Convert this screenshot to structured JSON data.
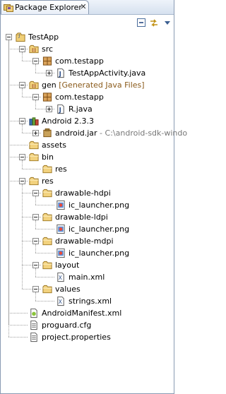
{
  "view": {
    "tab_title": "Package Explorer",
    "close_glyph": "✕",
    "toolbar": [
      "collapse-all-icon",
      "link-with-editor-icon",
      "view-menu-icon"
    ]
  },
  "tree": [
    {
      "label": "TestApp",
      "icon": "java-project-icon",
      "toggle": "expanded",
      "level": 0
    },
    {
      "label": "src",
      "icon": "source-folder-icon",
      "toggle": "expanded",
      "level": 1
    },
    {
      "label": "com.testapp",
      "icon": "package-icon",
      "toggle": "expanded",
      "level": 2
    },
    {
      "label": "TestAppActivity.java",
      "icon": "java-file-icon",
      "toggle": "collapsed",
      "level": 3
    },
    {
      "label": "gen",
      "decoration": "[Generated Java Files]",
      "icon": "source-folder-icon",
      "toggle": "expanded",
      "level": 1
    },
    {
      "label": "com.testapp",
      "icon": "package-icon",
      "toggle": "expanded",
      "level": 2
    },
    {
      "label": "R.java",
      "icon": "java-file-icon",
      "toggle": "collapsed",
      "level": 3
    },
    {
      "label": "Android 2.3.3",
      "icon": "library-icon",
      "toggle": "expanded",
      "level": 1
    },
    {
      "label": "android.jar",
      "decoration": "- C:\\android-sdk-windo",
      "icon": "jar-icon",
      "toggle": "collapsed",
      "level": 2
    },
    {
      "label": "assets",
      "icon": "folder-icon",
      "toggle": "none",
      "level": 1
    },
    {
      "label": "bin",
      "icon": "folder-icon",
      "toggle": "expanded",
      "level": 1
    },
    {
      "label": "res",
      "icon": "folder-icon",
      "toggle": "none",
      "level": 2
    },
    {
      "label": "res",
      "icon": "folder-icon",
      "toggle": "expanded",
      "level": 1
    },
    {
      "label": "drawable-hdpi",
      "icon": "folder-icon",
      "toggle": "expanded",
      "level": 2
    },
    {
      "label": "ic_launcher.png",
      "icon": "image-file-icon",
      "toggle": "none",
      "level": 3
    },
    {
      "label": "drawable-ldpi",
      "icon": "folder-icon",
      "toggle": "expanded",
      "level": 2
    },
    {
      "label": "ic_launcher.png",
      "icon": "image-file-icon",
      "toggle": "none",
      "level": 3
    },
    {
      "label": "drawable-mdpi",
      "icon": "folder-icon",
      "toggle": "expanded",
      "level": 2
    },
    {
      "label": "ic_launcher.png",
      "icon": "image-file-icon",
      "toggle": "none",
      "level": 3
    },
    {
      "label": "layout",
      "icon": "folder-icon",
      "toggle": "expanded",
      "level": 2
    },
    {
      "label": "main.xml",
      "icon": "xml-file-icon",
      "toggle": "none",
      "level": 3
    },
    {
      "label": "values",
      "icon": "folder-icon",
      "toggle": "expanded",
      "level": 2
    },
    {
      "label": "strings.xml",
      "icon": "xml-file-icon",
      "toggle": "none",
      "level": 3
    },
    {
      "label": "AndroidManifest.xml",
      "icon": "android-manifest-icon",
      "toggle": "none",
      "level": 1
    },
    {
      "label": "proguard.cfg",
      "icon": "text-file-icon",
      "toggle": "none",
      "level": 1
    },
    {
      "label": "project.properties",
      "icon": "text-file-icon",
      "toggle": "none",
      "level": 1
    }
  ],
  "colors": {
    "decoration_generated": "#8a5a1a",
    "decoration_path": "#777777",
    "selection_border": "#8a9bb3"
  }
}
